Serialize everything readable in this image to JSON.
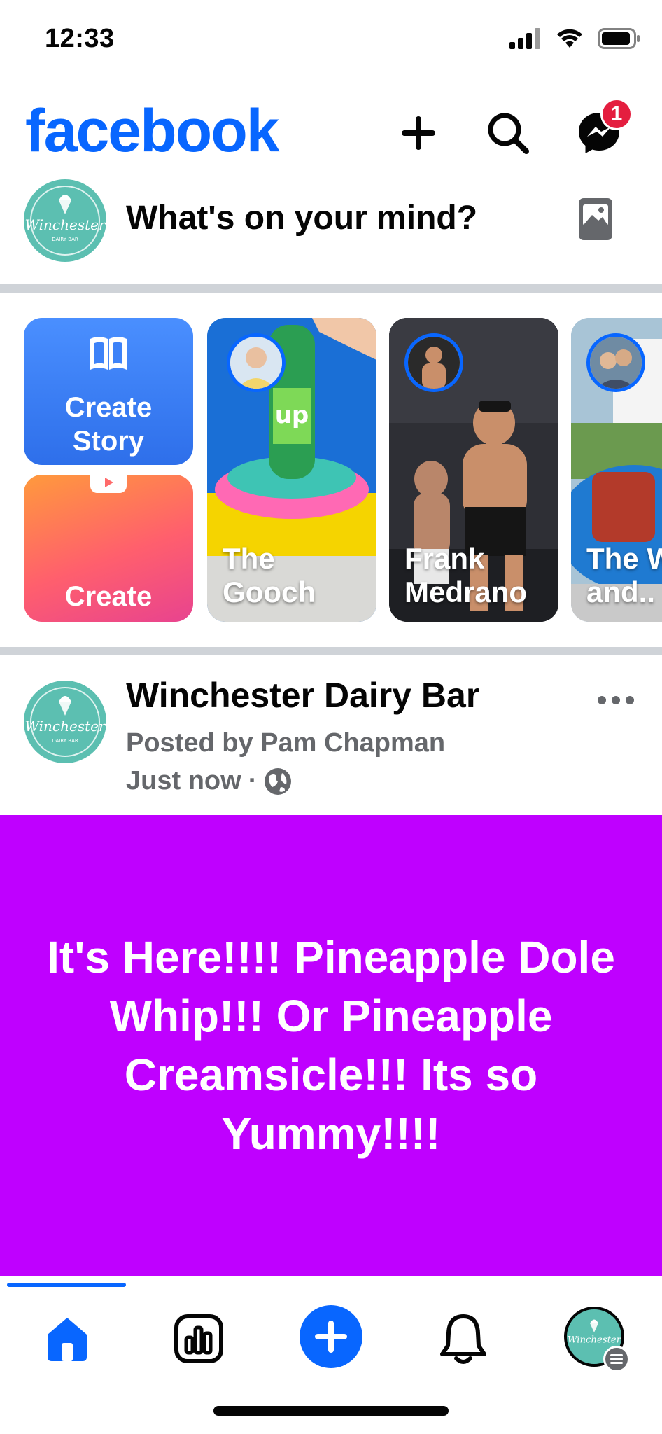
{
  "status": {
    "time": "12:33"
  },
  "header": {
    "brand": "facebook",
    "messenger_badge": "1",
    "icons": [
      "plus-icon",
      "search-icon",
      "messenger-icon"
    ]
  },
  "composer": {
    "placeholder": "What's on your mind?",
    "avatar_text": "Winchester"
  },
  "stories": {
    "create_story_label": "Create\nStory",
    "create_reel_label": "Create",
    "items": [
      {
        "name": "The\nGooch"
      },
      {
        "name": "Frank\nMedrano"
      },
      {
        "name": "The W\nand.."
      }
    ]
  },
  "post": {
    "page_name": "Winchester Dairy Bar",
    "posted_by": "Posted by Pam Chapman",
    "time": "Just now",
    "separator": "·",
    "text": "It's Here!!!! Pineapple Dole Whip!!! Or Pineapple Creamsicle!!! Its so Yummy!!!!",
    "background_color": "#bf00ff"
  },
  "colors": {
    "brand": "#0866ff",
    "badge": "#e41e3f"
  }
}
